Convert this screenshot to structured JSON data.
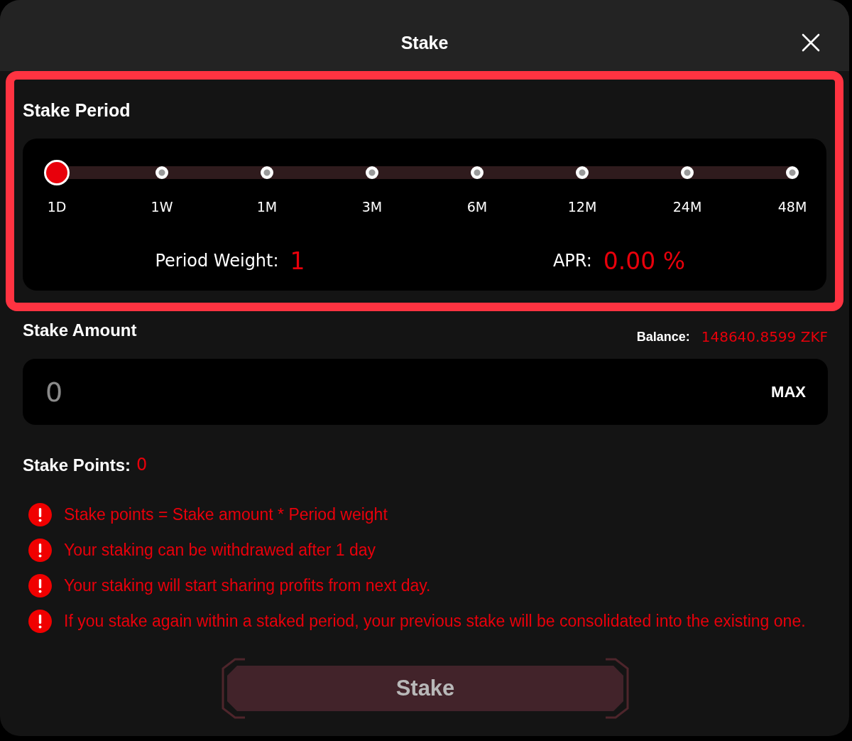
{
  "dialog": {
    "title": "Stake"
  },
  "stake_period": {
    "highlighted": true,
    "label": "Stake Period",
    "periods": [
      {
        "label": "1D",
        "selected": true
      },
      {
        "label": "1W",
        "selected": false
      },
      {
        "label": "1M",
        "selected": false
      },
      {
        "label": "3M",
        "selected": false
      },
      {
        "label": "6M",
        "selected": false
      },
      {
        "label": "12M",
        "selected": false
      },
      {
        "label": "24M",
        "selected": false
      },
      {
        "label": "48M",
        "selected": false
      }
    ],
    "weight_label": "Period Weight:",
    "weight_value": "1",
    "apr_label": "APR:",
    "apr_value": "0.00 %"
  },
  "stake_amount": {
    "label": "Stake Amount",
    "balance_label": "Balance:",
    "balance_value": "148640.8599 ZKF",
    "input": {
      "placeholder": "0"
    },
    "max_button": "MAX"
  },
  "stake_points": {
    "label": "Stake Points:",
    "value": "0"
  },
  "notices": [
    "Stake points = Stake amount * Period weight",
    "Your staking can be withdrawed after 1 day",
    "Your staking will start sharing profits from next day.",
    "If you stake again within a staked period, your previous stake will be consolidated into the existing one."
  ],
  "submit_button": {
    "label": "Stake",
    "disabled": true
  }
}
